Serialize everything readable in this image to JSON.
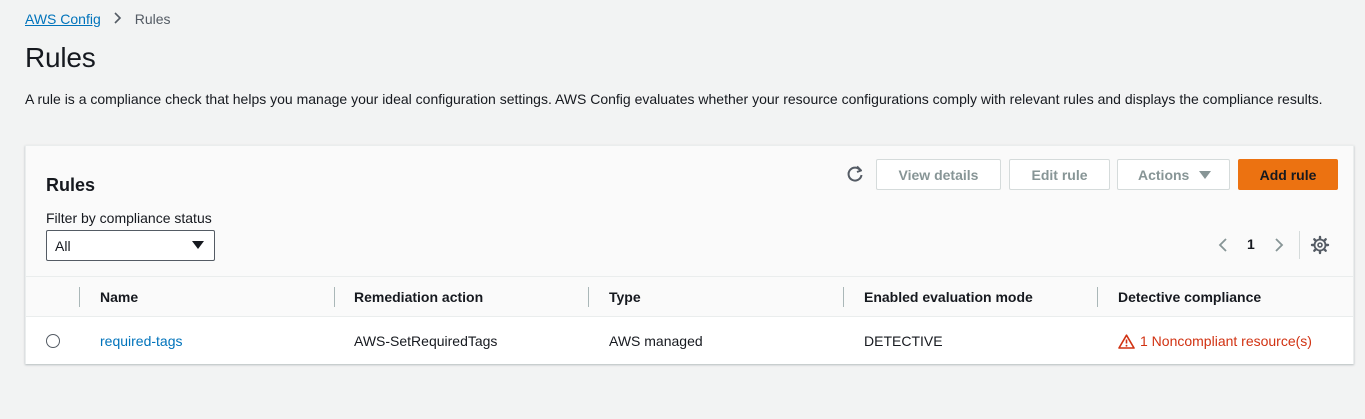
{
  "breadcrumb": {
    "root": "AWS Config",
    "current": "Rules"
  },
  "page": {
    "title": "Rules",
    "description": "A rule is a compliance check that helps you manage your ideal configuration settings. AWS Config evaluates whether your resource configurations comply with relevant rules and displays the compliance results."
  },
  "panel": {
    "title": "Rules",
    "filter_label": "Filter by compliance status",
    "filter_value": "All",
    "buttons": {
      "view_details": "View details",
      "edit_rule": "Edit rule",
      "actions": "Actions",
      "add_rule": "Add rule"
    },
    "pagination": {
      "current_page": "1"
    },
    "icons": [
      "refresh-icon",
      "chevron-left-icon",
      "chevron-right-icon",
      "settings-icon",
      "warning-icon"
    ]
  },
  "table": {
    "columns": [
      "Name",
      "Remediation action",
      "Type",
      "Enabled evaluation mode",
      "Detective compliance"
    ],
    "rows": [
      {
        "name": "required-tags",
        "remediation": "AWS-SetRequiredTags",
        "type": "AWS managed",
        "mode": "DETECTIVE",
        "compliance": "1 Noncompliant resource(s)"
      }
    ]
  },
  "colors": {
    "link": "#0073bb",
    "primary_button": "#ec7211",
    "error": "#d13212",
    "background": "#f2f3f3"
  }
}
